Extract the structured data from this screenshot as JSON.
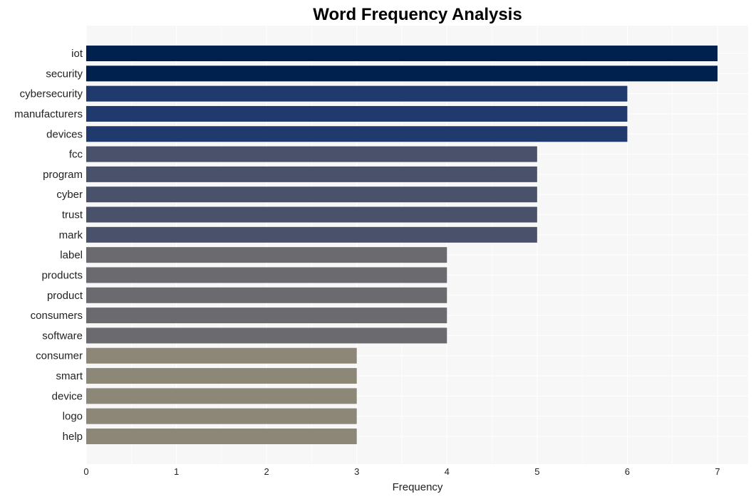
{
  "chart_data": {
    "type": "bar",
    "orientation": "horizontal",
    "title": "Word Frequency Analysis",
    "xlabel": "Frequency",
    "ylabel": "",
    "xlim": [
      0,
      7.35
    ],
    "xticks": [
      0,
      1,
      2,
      3,
      4,
      5,
      6,
      7
    ],
    "grid": true,
    "categories": [
      "iot",
      "security",
      "cybersecurity",
      "manufacturers",
      "devices",
      "fcc",
      "program",
      "cyber",
      "trust",
      "mark",
      "label",
      "products",
      "product",
      "consumers",
      "software",
      "consumer",
      "smart",
      "device",
      "logo",
      "help"
    ],
    "values": [
      7,
      7,
      6,
      6,
      6,
      5,
      5,
      5,
      5,
      5,
      4,
      4,
      4,
      4,
      4,
      3,
      3,
      3,
      3,
      3
    ],
    "colors_by_value": {
      "7": "#00214e",
      "6": "#213a6e",
      "5": "#4a526b",
      "4": "#6b6b6f",
      "3": "#8c8777"
    },
    "background": "#f7f7f7"
  }
}
